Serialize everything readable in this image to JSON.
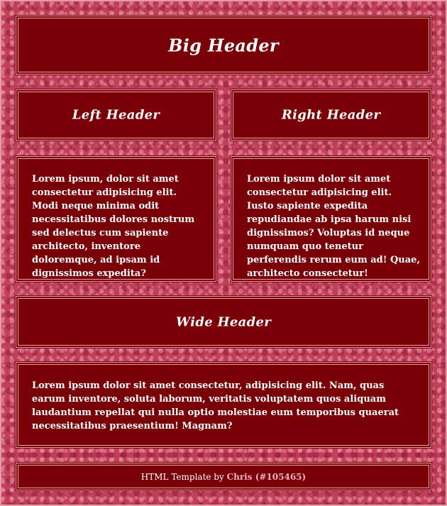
{
  "big_header": "Big Header",
  "left_header": "Left Header",
  "right_header": "Right Header",
  "left_body": "Lorem ipsum, dolor sit amet consectetur adipisicing elit. Modi neque minima odit necessitatibus dolores nostrum sed delectus cum sapiente architecto, inventore doloremque, ad ipsam id dignissimos expedita?",
  "right_body": "Lorem ipsum dolor sit amet consectetur adipisicing elit. Iusto sapiente expedita repudiandae ab ipsa harum nisi dignissimos? Voluptas id neque numquam quo tenetur perferendis rerum eum ad! Quae, architecto consectetur!",
  "wide_header": "Wide Header",
  "wide_body": "Lorem ipsum dolor sit amet consectetur, adipisicing elit. Nam, quas earum inventore, soluta laborum, veritatis voluptatem quos aliquam laudantium repellat qui nulla optio molestiae eum temporibus quaerat necessitatibus praesentium! Magnam?",
  "footer": {
    "prefix": "HTML Template by ",
    "author": "Chris",
    "id": "(#105465)"
  },
  "colors": {
    "panel": "#7a0008",
    "panel_border": "#e8a0ac",
    "background": "#c0405a",
    "link": "#f0b2c0"
  }
}
